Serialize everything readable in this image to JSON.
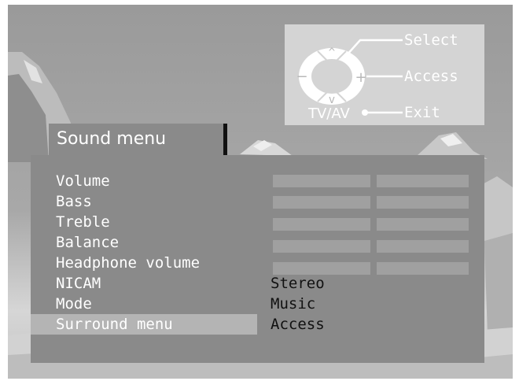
{
  "remote_help": {
    "select_label": "Select",
    "access_label": "Access",
    "exit_label": "Exit",
    "tv_av_label": "TV/AV",
    "plus_symbol": "+",
    "minus_symbol": "−",
    "up_symbol": "^",
    "down_symbol": "v"
  },
  "sound_menu": {
    "title": "Sound menu",
    "items": [
      {
        "label": "Volume",
        "control": "slider"
      },
      {
        "label": "Bass",
        "control": "slider"
      },
      {
        "label": "Treble",
        "control": "slider"
      },
      {
        "label": "Balance",
        "control": "slider"
      },
      {
        "label": "Headphone volume",
        "control": "slider"
      },
      {
        "label": "NICAM",
        "value": "Stereo"
      },
      {
        "label": "Mode",
        "value": "Music"
      },
      {
        "label": "Surround menu",
        "value": "Access",
        "highlighted": true
      }
    ]
  },
  "colors": {
    "menu_panel": "#8a8a8a",
    "highlight": "#b4b4b4",
    "remote_panel": "#d4d4d4",
    "menu_text": "#ffffff",
    "value_text": "#111111"
  }
}
